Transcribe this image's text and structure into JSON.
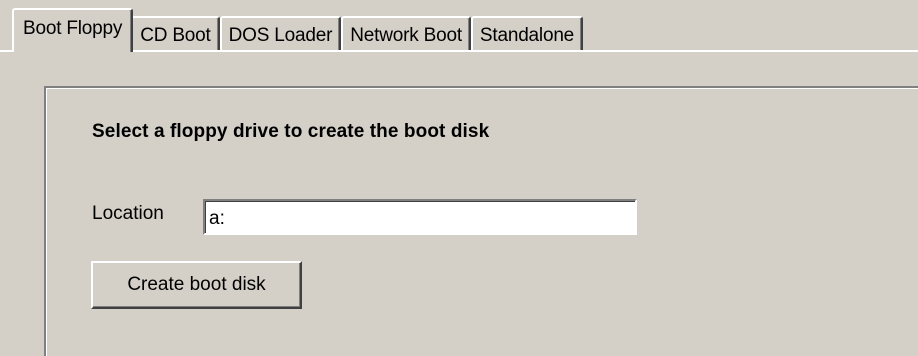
{
  "tabs": [
    {
      "label": "Boot Floppy",
      "selected": true
    },
    {
      "label": "CD Boot",
      "selected": false
    },
    {
      "label": "DOS Loader",
      "selected": false
    },
    {
      "label": "Network Boot",
      "selected": false
    },
    {
      "label": "Standalone",
      "selected": false
    }
  ],
  "panel": {
    "heading": "Select a floppy drive to create the boot disk",
    "location_label": "Location",
    "location_value": "a:",
    "create_button_label": "Create boot disk"
  },
  "colors": {
    "face": "#d4d0c8",
    "highlight": "#ffffff",
    "shadow": "#808080",
    "dark_shadow": "#404040",
    "field": "#ffffff"
  }
}
